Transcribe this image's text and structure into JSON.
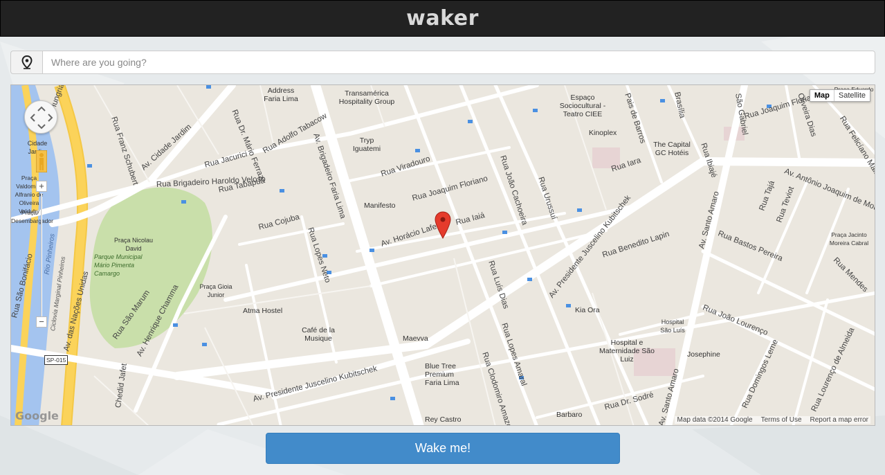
{
  "app": {
    "brand": "waker"
  },
  "search": {
    "placeholder": "Where are you going?",
    "value": "",
    "icon": "location-pin-icon"
  },
  "map": {
    "type_controls": {
      "map_label": "Map",
      "satellite_label": "Satellite",
      "active": "Map"
    },
    "attribution": {
      "data": "Map data ©2014 Google",
      "terms": "Terms of Use",
      "report": "Report a map error"
    },
    "logo": "Google",
    "streets": [
      "Rua Brigadeiro Haroldo Veloso",
      "Av. Cidade Jardim",
      "Rua Jacurici",
      "Rua Dr. Mário Ferraz",
      "Rua Adolfo Tabacow",
      "Rua Tabapuã",
      "Rua Cojuba",
      "Rua Lopes Neto",
      "Av. Brigadeiro Faria Lima",
      "Rua Viradouro",
      "Rua Joaquim Floriano",
      "Av. Horácio Lafer",
      "Rua Iaiá",
      "Rua João Cachoeira",
      "Rua Urussuí",
      "Rua Luís Dias",
      "Av. Presidente Juscelino Kubitschek",
      "Rua Benedito Lapin",
      "Rua Iara",
      "Av. Antônio Joaquim de Moura",
      "Av. Santo Amaro",
      "Rua Bastos Pereira",
      "Rua João Lourenço",
      "Rua Domingos Leme",
      "Rua Lourenço de Almeida",
      "Rua Dr. Sodré",
      "Rua Lopes Amaral",
      "Rua Clodomiro Amazonas",
      "Av. Henrique Chamma",
      "Rua São Marum",
      "Av. das Nações Unidas",
      "Rua São Bonifácio",
      "Rua Franz Schubert",
      "Hungria",
      "Rua Tajá",
      "Rua Teviot",
      "Rua Mendes",
      "Rua Felicíano Maia",
      "Chedid Jafet",
      "Rua Tabapuã",
      "Rua Joaquim Floriano",
      "Rua Ibiajé",
      "Brasília",
      "São Gabriel",
      "Oliveira Dias",
      "Pais de Barros",
      "Rio Pinheiros",
      "Ciclovia Marginal Pinheiros"
    ],
    "pois": [
      "Address Faria Lima",
      "Transamérica Hospitality Group",
      "Tryp Iguatemi",
      "Manifesto",
      "Praça Nicolau David",
      "Parque Municipal Mário Pimenta Camargo",
      "Praça Valdomiro Alfranio de Oliveira Valduhy",
      "Praça Gioia Junior",
      "Atma Hostel",
      "Café de la Musique",
      "Maevva",
      "Blue Tree Premium Faria Lima",
      "Rey Castro",
      "Espaço Sociocultural - Teatro CIEE",
      "Kinoplex",
      "The Capital GC Hotéis",
      "Kia Ora",
      "Hospital São Luís",
      "Hospital e Maternidade São Luiz",
      "Josephine",
      "Barbaro",
      "Praça Jacinto Moreira Cabral",
      "Cidade Jardim",
      "Praça Desembargador",
      "SP-015",
      "Praça Eduardo Liberal Pinto"
    ],
    "marker": "red-pin"
  },
  "wake_button": {
    "label": "Wake me!"
  },
  "colors": {
    "topbar": "#222222",
    "brand_text": "#d9d9d9",
    "button": "#428bca",
    "park": "#c9dfaa",
    "water": "#a4c4ef",
    "highway": "#fbd35a"
  }
}
